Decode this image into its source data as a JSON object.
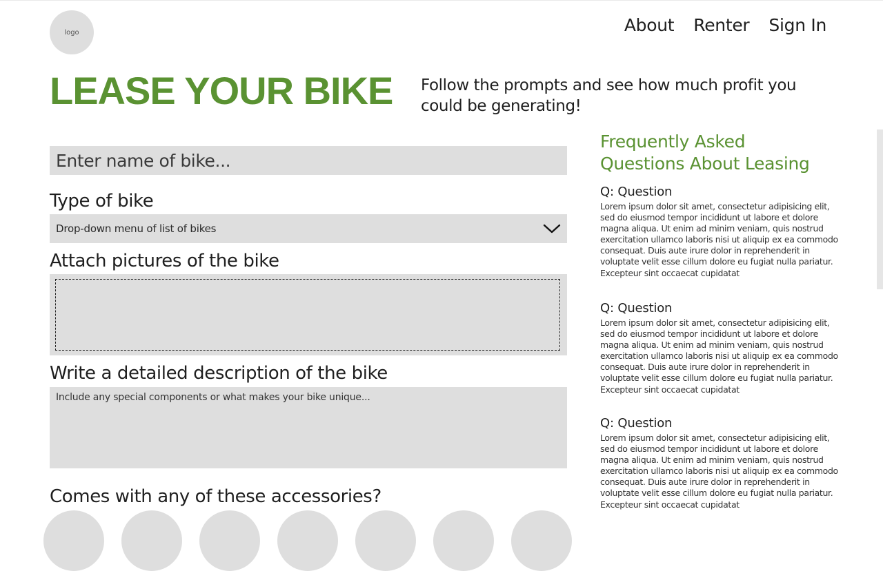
{
  "header": {
    "logo_text": "logo",
    "nav": [
      {
        "label": "About"
      },
      {
        "label": "Renter"
      },
      {
        "label": "Sign In"
      }
    ]
  },
  "hero": {
    "title": "LEASE YOUR BIKE",
    "subtitle": "Follow the prompts and see how much profit you could be generating!"
  },
  "form": {
    "name_placeholder": "Enter name of bike...",
    "type_label": "Type of bike",
    "type_select_value": "Drop-down menu of list of bikes",
    "pictures_label": "Attach pictures of the bike",
    "description_label": "Write a detailed description of the bike",
    "description_placeholder": "Include any special components or what makes your bike unique...",
    "accessories_label": "Comes with any of these accessories?",
    "accessories_count": 7
  },
  "faq": {
    "title": "Frequently Asked Questions About Leasing",
    "items": [
      {
        "q": "Q: Question",
        "a": "Lorem ipsum dolor sit amet, consectetur adipisicing elit, sed do eiusmod tempor incididunt ut labore et dolore magna aliqua. Ut enim ad minim veniam, quis nostrud exercitation ullamco laboris nisi ut aliquip ex ea commodo consequat. Duis aute irure dolor in reprehenderit in voluptate velit esse cillum dolore eu fugiat nulla pariatur. Excepteur sint occaecat cupidatat"
      },
      {
        "q": "Q: Question",
        "a": "Lorem ipsum dolor sit amet, consectetur adipisicing elit, sed do eiusmod tempor incididunt ut labore et dolore magna aliqua. Ut enim ad minim veniam, quis nostrud exercitation ullamco laboris nisi ut aliquip ex ea commodo consequat. Duis aute irure dolor in reprehenderit in voluptate velit esse cillum dolore eu fugiat nulla pariatur. Excepteur sint occaecat cupidatat"
      },
      {
        "q": "Q: Question",
        "a": "Lorem ipsum dolor sit amet, consectetur adipisicing elit, sed do eiusmod tempor incididunt ut labore et dolore magna aliqua. Ut enim ad minim veniam, quis nostrud exercitation ullamco laboris nisi ut aliquip ex ea commodo consequat. Duis aute irure dolor in reprehenderit in voluptate velit esse cillum dolore eu fugiat nulla pariatur. Excepteur sint occaecat cupidatat"
      }
    ]
  },
  "colors": {
    "accent": "#5a9232",
    "field_bg": "#dedede"
  },
  "icons": {
    "select_chevron": "chevron-down-icon"
  }
}
